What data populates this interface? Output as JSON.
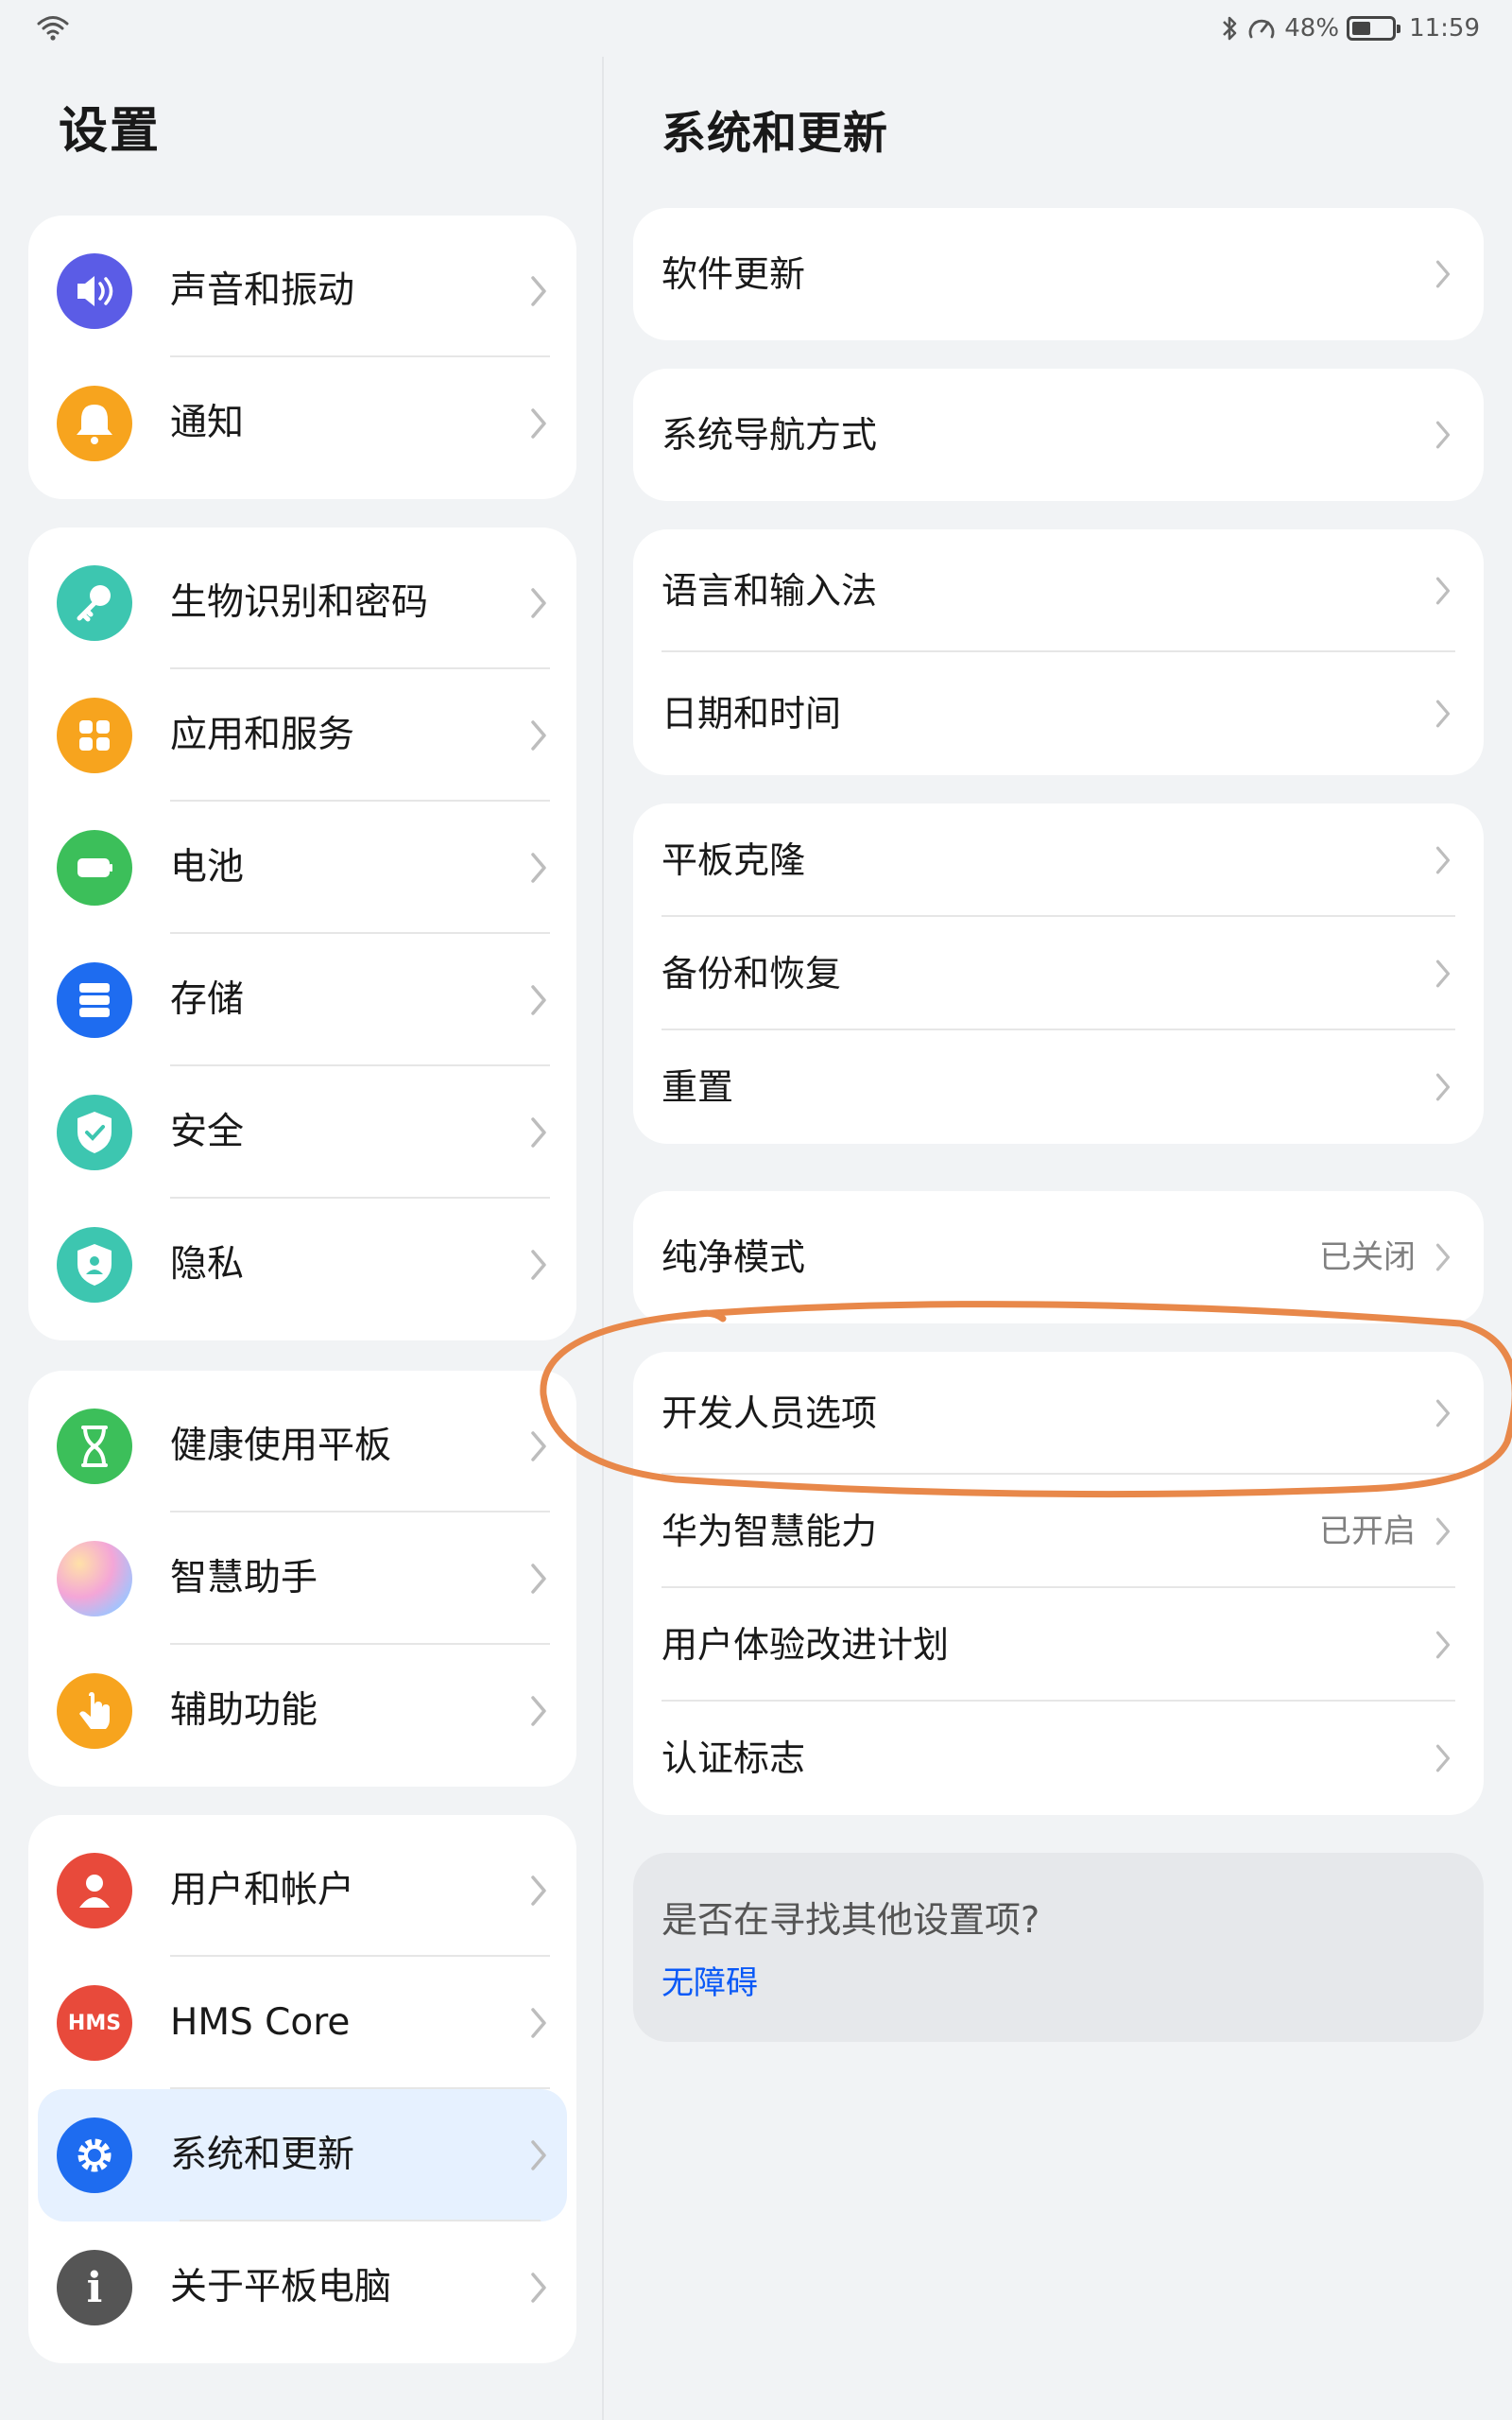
{
  "status": {
    "battery": "48%",
    "battery_level": 0.48,
    "time": "11:59"
  },
  "left": {
    "title": "设置",
    "groups": [
      {
        "items": [
          {
            "label": "声音和振动",
            "icon": "sound-icon",
            "color": "#5b5ce6"
          },
          {
            "label": "通知",
            "icon": "bell-icon",
            "color": "#f7a41e"
          }
        ]
      },
      {
        "items": [
          {
            "label": "生物识别和密码",
            "icon": "key-icon",
            "color": "#3dc6b0"
          },
          {
            "label": "应用和服务",
            "icon": "apps-icon",
            "color": "#f7a41e"
          },
          {
            "label": "电池",
            "icon": "battery-icon",
            "color": "#3cbf5a"
          },
          {
            "label": "存储",
            "icon": "storage-icon",
            "color": "#1e6cf0"
          },
          {
            "label": "安全",
            "icon": "shield-check-icon",
            "color": "#3dc6b0"
          },
          {
            "label": "隐私",
            "icon": "privacy-shield-icon",
            "color": "#3dc6b0"
          }
        ]
      },
      {
        "items": [
          {
            "label": "健康使用平板",
            "icon": "hourglass-icon",
            "color": "#3cbf5a"
          },
          {
            "label": "智慧助手",
            "icon": "assistant-icon",
            "color": "#e6a0d0"
          },
          {
            "label": "辅助功能",
            "icon": "accessibility-hand-icon",
            "color": "#f7a41e"
          }
        ]
      },
      {
        "items": [
          {
            "label": "用户和帐户",
            "icon": "user-icon",
            "color": "#e84a3b"
          },
          {
            "label": "HMS Core",
            "icon": "hms-icon",
            "icon_text": "HMS",
            "color": "#e84a3b"
          },
          {
            "label": "系统和更新",
            "icon": "gear-icon",
            "color": "#1e6cf0",
            "selected": true
          },
          {
            "label": "关于平板电脑",
            "icon": "info-icon",
            "icon_text": "i",
            "color": "#555555"
          }
        ]
      }
    ]
  },
  "right": {
    "title": "系统和更新",
    "groups": [
      {
        "items": [
          {
            "label": "软件更新"
          }
        ]
      },
      {
        "items": [
          {
            "label": "系统导航方式"
          }
        ]
      },
      {
        "items": [
          {
            "label": "语言和输入法"
          },
          {
            "label": "日期和时间"
          }
        ]
      },
      {
        "items": [
          {
            "label": "平板克隆"
          },
          {
            "label": "备份和恢复"
          },
          {
            "label": "重置"
          }
        ]
      },
      {
        "items": [
          {
            "label": "纯净模式",
            "value": "已关闭"
          }
        ]
      },
      {
        "items": [
          {
            "label": "开发人员选项"
          },
          {
            "label": "华为智慧能力",
            "value": "已开启"
          },
          {
            "label": "用户体验改进计划"
          },
          {
            "label": "认证标志"
          }
        ]
      }
    ],
    "info": {
      "question": "是否在寻找其他设置项?",
      "link": "无障碍"
    }
  },
  "colors": {
    "accent": "#0a59f7",
    "highlight_ring": "#e8884a",
    "selected_bg": "#e6f1ff"
  }
}
